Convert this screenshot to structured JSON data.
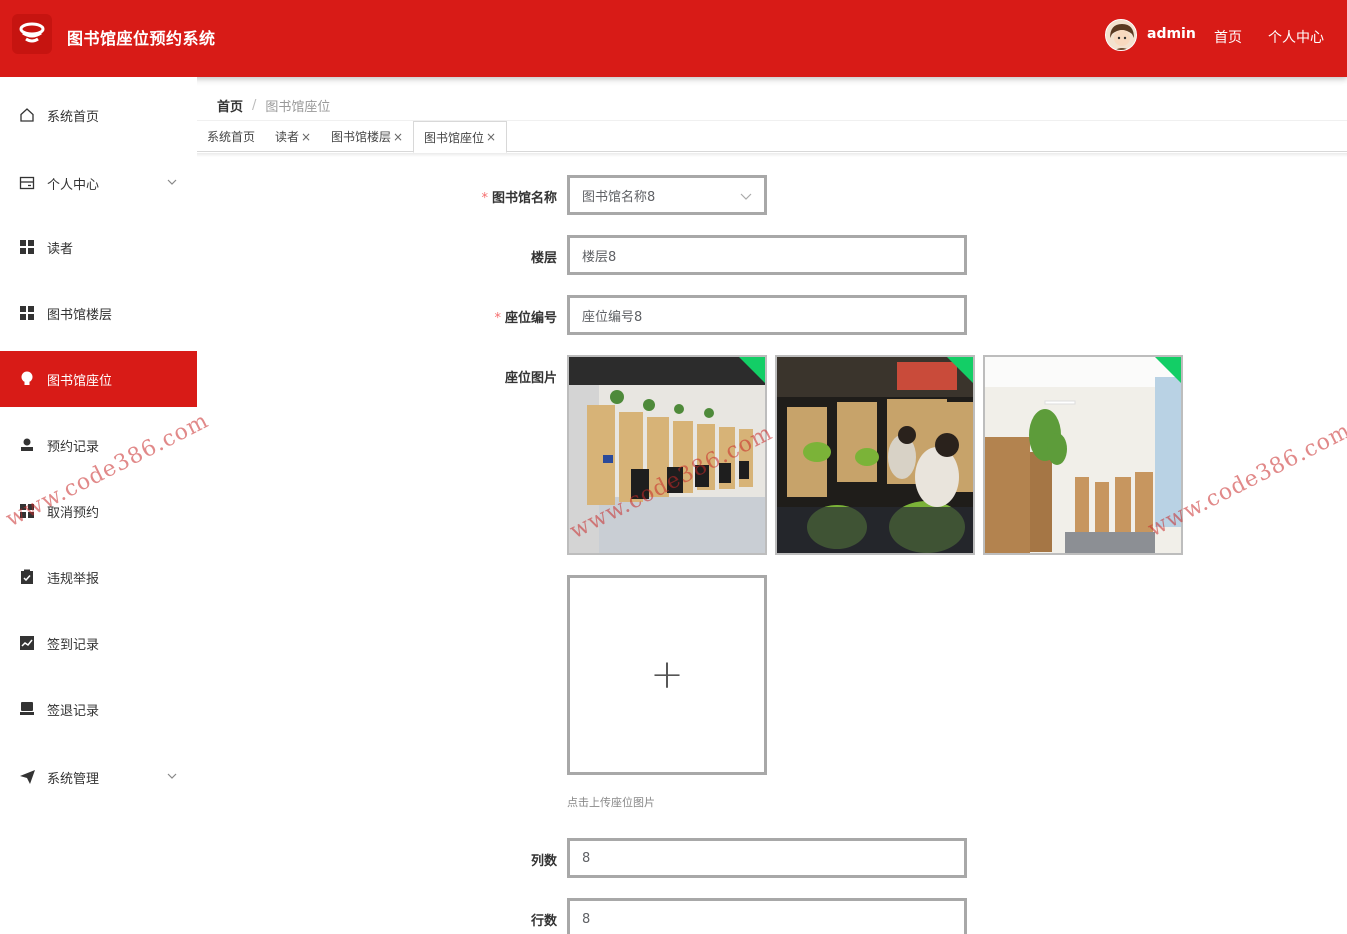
{
  "header": {
    "app_title": "图书馆座位预约系统",
    "user_name": "admin",
    "links": [
      "首页",
      "个人中心"
    ]
  },
  "sidebar": {
    "items": [
      {
        "label": "系统首页",
        "icon": "home-icon"
      },
      {
        "label": "个人中心",
        "icon": "card-icon"
      },
      {
        "label": "读者",
        "icon": "grid-icon"
      },
      {
        "label": "图书馆楼层",
        "icon": "grid-icon"
      },
      {
        "label": "图书馆座位",
        "icon": "bulb-icon"
      },
      {
        "label": "预约记录",
        "icon": "user-icon"
      },
      {
        "label": "取消预约",
        "icon": "grid-icon"
      },
      {
        "label": "违规举报",
        "icon": "clipboard-check-icon"
      },
      {
        "label": "签到记录",
        "icon": "chart-icon"
      },
      {
        "label": "签退记录",
        "icon": "stamp-icon"
      },
      {
        "label": "系统管理",
        "icon": "send-icon"
      }
    ],
    "active": "图书馆座位",
    "accent_color": "#d81b17"
  },
  "breadcrumb": {
    "home": "首页",
    "separator": "/",
    "current": "图书馆座位"
  },
  "tabs": [
    {
      "label": "系统首页",
      "closable": false
    },
    {
      "label": "读者",
      "closable": true
    },
    {
      "label": "图书馆楼层",
      "closable": true
    },
    {
      "label": "图书馆座位",
      "closable": true
    }
  ],
  "tab_close": "×",
  "form": {
    "library_name": {
      "label": "图书馆名称",
      "value": "图书馆名称8",
      "required": true
    },
    "floor": {
      "label": "楼层",
      "value": "楼层8"
    },
    "seat_no": {
      "label": "座位编号",
      "value": "座位编号8",
      "required": true
    },
    "seat_image": {
      "label": "座位图片",
      "upload_tip": "点击上传座位图片",
      "image_count": 3
    },
    "columns": {
      "label": "列数",
      "value": "8"
    },
    "rows": {
      "label": "行数",
      "value": "8"
    }
  },
  "required_mark": "*",
  "upload_plus": "+",
  "watermark": "www.code386.com"
}
